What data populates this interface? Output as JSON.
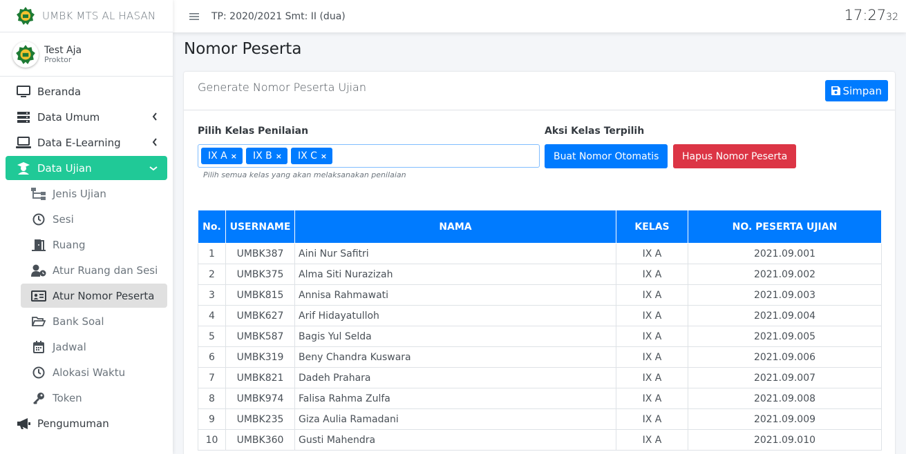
{
  "brand": {
    "name": "UMBK MTS AL HASAN"
  },
  "user": {
    "name": "Test Aja",
    "role": "Proktor"
  },
  "header": {
    "tp": "TP: 2020/2021 Smt: II (dua)",
    "clock_hm": "17:27",
    "clock_s": "32"
  },
  "nav": {
    "beranda": "Beranda",
    "data_umum": "Data Umum",
    "data_elearning": "Data E-Learning",
    "data_ujian": "Data Ujian",
    "sub": {
      "jenis_ujian": "Jenis Ujian",
      "sesi": "Sesi",
      "ruang": "Ruang",
      "atur_ruang_sesi": "Atur Ruang dan Sesi",
      "atur_nomor_peserta": "Atur Nomor Peserta",
      "bank_soal": "Bank Soal",
      "jadwal": "Jadwal",
      "alokasi_waktu": "Alokasi Waktu",
      "token": "Token"
    },
    "pengumuman": "Pengumuman"
  },
  "page": {
    "title": "Nomor Peserta"
  },
  "card": {
    "title": "Generate Nomor Peserta Ujian",
    "save_label": "Simpan",
    "pilih_label": "Pilih Kelas Penilaian",
    "aksi_label": "Aksi Kelas Terpilih",
    "tags": [
      "IX A",
      "IX B",
      "IX C"
    ],
    "help": "Pilih semua kelas yang akan melaksanakan penilaian",
    "btn_auto": "Buat Nomor Otomatis",
    "btn_hapus": "Hapus Nomor Peserta"
  },
  "table": {
    "headers": [
      "No.",
      "USERNAME",
      "NAMA",
      "KELAS",
      "NO. PESERTA UJIAN"
    ],
    "rows": [
      [
        "1",
        "UMBK387",
        "Aini Nur Safitri",
        "IX A",
        "2021.09.001"
      ],
      [
        "2",
        "UMBK375",
        "Alma Siti Nurazizah",
        "IX A",
        "2021.09.002"
      ],
      [
        "3",
        "UMBK815",
        "Annisa Rahmawati",
        "IX A",
        "2021.09.003"
      ],
      [
        "4",
        "UMBK627",
        "Arif Hidayatulloh",
        "IX A",
        "2021.09.004"
      ],
      [
        "5",
        "UMBK587",
        "Bagis Yul Selda",
        "IX A",
        "2021.09.005"
      ],
      [
        "6",
        "UMBK319",
        "Beny Chandra Kuswara",
        "IX A",
        "2021.09.006"
      ],
      [
        "7",
        "UMBK821",
        "Dadeh Prahara",
        "IX A",
        "2021.09.007"
      ],
      [
        "8",
        "UMBK974",
        "Falisa Rahma Zulfa",
        "IX A",
        "2021.09.008"
      ],
      [
        "9",
        "UMBK235",
        "Giza Aulia Ramadani",
        "IX A",
        "2021.09.009"
      ],
      [
        "10",
        "UMBK360",
        "Gusti Mahendra",
        "IX A",
        "2021.09.010"
      ]
    ]
  },
  "colors": {
    "primary": "#007bff",
    "danger": "#dc3545",
    "success": "#20c997"
  }
}
